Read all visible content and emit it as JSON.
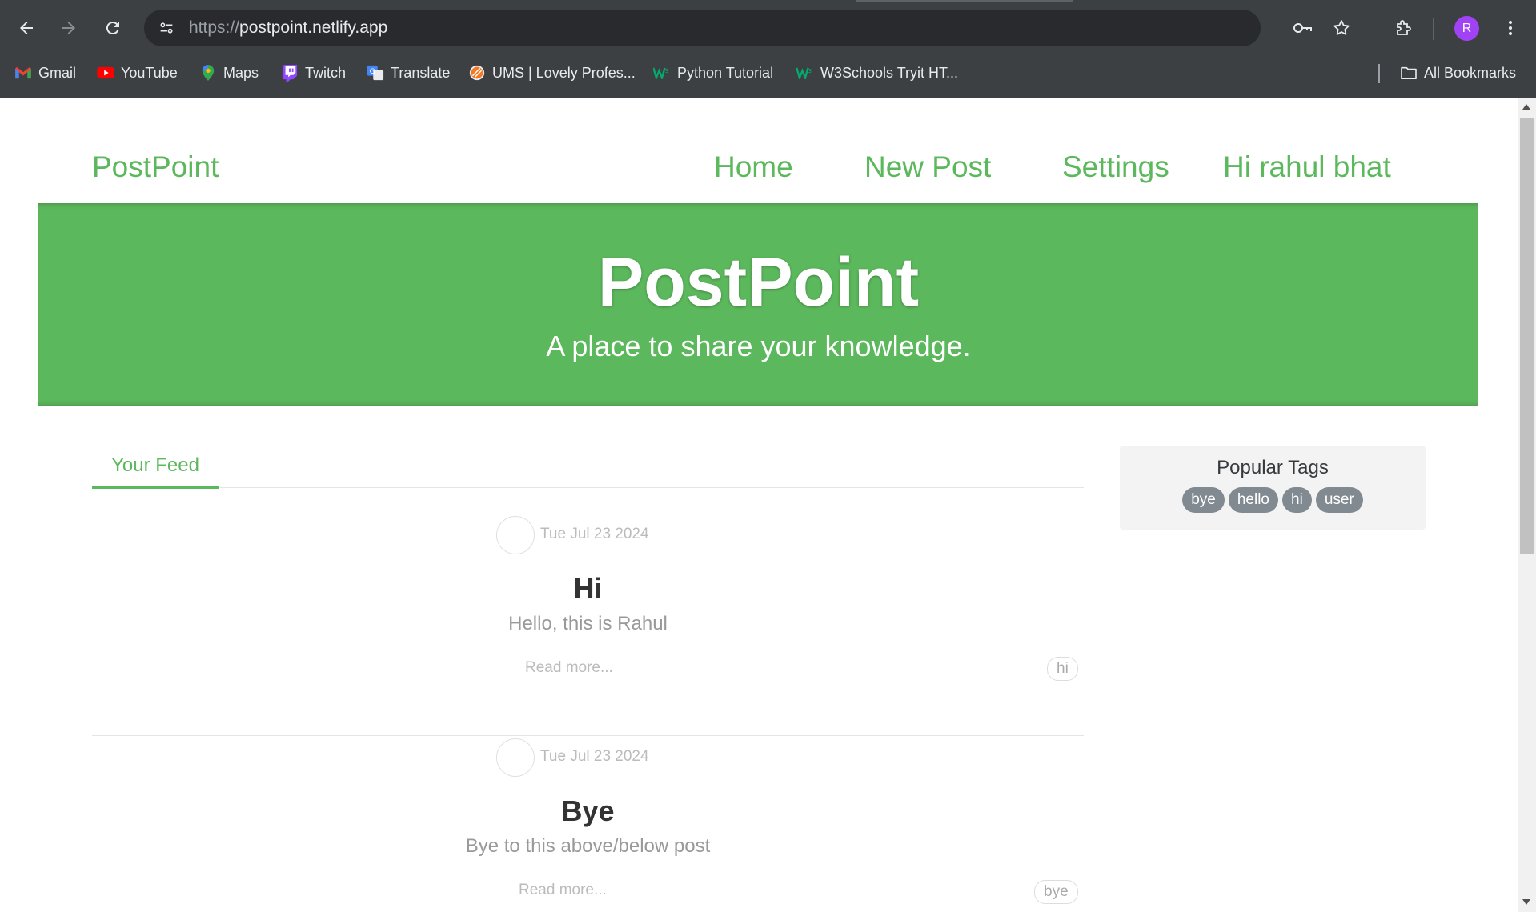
{
  "browser": {
    "url_scheme": "https://",
    "url_host": "postpoint.netlify.app",
    "profile_initial": "R",
    "bookmarks": [
      {
        "label": "Gmail",
        "icon": "gmail-icon"
      },
      {
        "label": "YouTube",
        "icon": "youtube-icon"
      },
      {
        "label": "Maps",
        "icon": "maps-icon"
      },
      {
        "label": "Twitch",
        "icon": "twitch-icon"
      },
      {
        "label": "Translate",
        "icon": "translate-icon"
      },
      {
        "label": "UMS | Lovely Profes...",
        "icon": "ums-icon"
      },
      {
        "label": "Python Tutorial",
        "icon": "w3schools-icon"
      },
      {
        "label": "W3Schools Tryit HT...",
        "icon": "w3schools-icon"
      }
    ],
    "all_bookmarks_label": "All Bookmarks"
  },
  "navbar": {
    "brand": "PostPoint",
    "links": [
      "Home",
      "New Post",
      "Settings",
      "Hi rahul bhat"
    ]
  },
  "banner": {
    "title": "PostPoint",
    "subtitle": "A place to share your knowledge."
  },
  "feed": {
    "tab_label": "Your Feed",
    "articles": [
      {
        "date": "Tue Jul 23 2024",
        "title": "Hi",
        "description": "Hello, this is Rahul",
        "read_more": "Read more...",
        "tag": "hi"
      },
      {
        "date": "Tue Jul 23 2024",
        "title": "Bye",
        "description": "Bye to this above/below post",
        "read_more": "Read more...",
        "tag": "bye"
      }
    ]
  },
  "sidebar": {
    "title": "Popular Tags",
    "tags": [
      "bye",
      "hello",
      "hi",
      "user"
    ]
  },
  "colors": {
    "brand_green": "#5cb85c",
    "chrome_bg": "#3c4043",
    "tag_pill": "#818a91"
  }
}
